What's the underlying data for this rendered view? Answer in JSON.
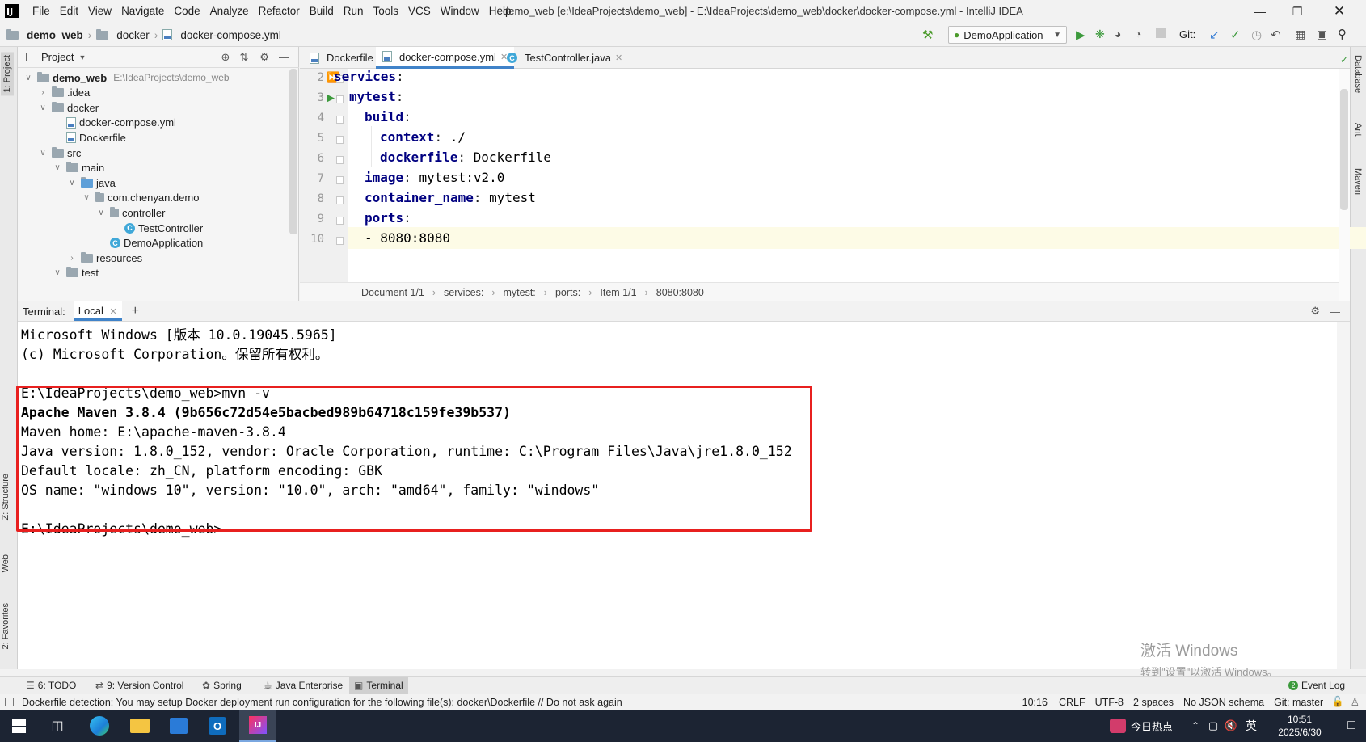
{
  "menubar": {
    "logo": "IJ",
    "items": [
      "File",
      "Edit",
      "View",
      "Navigate",
      "Code",
      "Analyze",
      "Refactor",
      "Build",
      "Run",
      "Tools",
      "VCS",
      "Window",
      "Help"
    ],
    "title": "demo_web [e:\\IdeaProjects\\demo_web] - E:\\IdeaProjects\\demo_web\\docker\\docker-compose.yml - IntelliJ IDEA"
  },
  "navbar": {
    "crumbs": [
      "demo_web",
      "docker",
      "docker-compose.yml"
    ],
    "run_config": "DemoApplication",
    "git_label": "Git:"
  },
  "leftstrip": {
    "project": "1: Project",
    "structure": "Z: Structure",
    "web": "Web",
    "favorites": "2: Favorites"
  },
  "rightstrip": {
    "database": "Database",
    "ant": "Ant",
    "maven": "Maven"
  },
  "project": {
    "title": "Project",
    "tree": [
      {
        "label": "demo_web",
        "extra": "E:\\IdeaProjects\\demo_web",
        "indent": 0,
        "arrow": "v",
        "type": "folder",
        "bold": true
      },
      {
        "label": ".idea",
        "extra": "",
        "indent": 1,
        "arrow": ">",
        "type": "folder",
        "bold": false
      },
      {
        "label": "docker",
        "extra": "",
        "indent": 1,
        "arrow": "v",
        "type": "folder",
        "bold": false
      },
      {
        "label": "docker-compose.yml",
        "extra": "",
        "indent": 2,
        "arrow": "",
        "type": "yml",
        "bold": false
      },
      {
        "label": "Dockerfile",
        "extra": "",
        "indent": 2,
        "arrow": "",
        "type": "yml",
        "bold": false
      },
      {
        "label": "src",
        "extra": "",
        "indent": 1,
        "arrow": "v",
        "type": "folder",
        "bold": false
      },
      {
        "label": "main",
        "extra": "",
        "indent": 2,
        "arrow": "v",
        "type": "folder",
        "bold": false
      },
      {
        "label": "java",
        "extra": "",
        "indent": 3,
        "arrow": "v",
        "type": "folderblue",
        "bold": false
      },
      {
        "label": "com.chenyan.demo",
        "extra": "",
        "indent": 4,
        "arrow": "v",
        "type": "pkg",
        "bold": false
      },
      {
        "label": "controller",
        "extra": "",
        "indent": 5,
        "arrow": "v",
        "type": "pkg",
        "bold": false
      },
      {
        "label": "TestController",
        "extra": "",
        "indent": 6,
        "arrow": "",
        "type": "class",
        "bold": false
      },
      {
        "label": "DemoApplication",
        "extra": "",
        "indent": 5,
        "arrow": "",
        "type": "class",
        "bold": false
      },
      {
        "label": "resources",
        "extra": "",
        "indent": 3,
        "arrow": ">",
        "type": "folder",
        "bold": false
      },
      {
        "label": "test",
        "extra": "",
        "indent": 2,
        "arrow": "v",
        "type": "folder",
        "bold": false
      }
    ]
  },
  "editor": {
    "tabs": [
      {
        "label": "Dockerfile",
        "active": false
      },
      {
        "label": "docker-compose.yml",
        "active": true
      },
      {
        "label": "TestController.java",
        "active": false
      }
    ],
    "lines": [
      {
        "n": "2",
        "key": "services",
        "val": "",
        "indent": 0
      },
      {
        "n": "3",
        "key": "mytest",
        "val": "",
        "indent": 1
      },
      {
        "n": "4",
        "key": "build",
        "val": "",
        "indent": 2
      },
      {
        "n": "5",
        "key": "context",
        "val": " ./",
        "indent": 3
      },
      {
        "n": "6",
        "key": "dockerfile",
        "val": " Dockerfile",
        "indent": 3
      },
      {
        "n": "7",
        "key": "image",
        "val": " mytest:v2.0",
        "indent": 2
      },
      {
        "n": "8",
        "key": "container_name",
        "val": " mytest",
        "indent": 2
      },
      {
        "n": "9",
        "key": "ports",
        "val": "",
        "indent": 2
      },
      {
        "n": "10",
        "key": "",
        "val": "- 8080:8080",
        "indent": 2
      }
    ],
    "breadcrumb": [
      "Document 1/1",
      "services:",
      "mytest:",
      "ports:",
      "Item 1/1",
      "8080:8080"
    ]
  },
  "terminal": {
    "label": "Terminal:",
    "tab": "Local",
    "lines": [
      {
        "text": "Microsoft Windows [版本 10.0.19045.5965]",
        "bold": false
      },
      {
        "text": "(c) Microsoft Corporation。保留所有权利。",
        "bold": false
      },
      {
        "text": "",
        "bold": false
      },
      {
        "text": "E:\\IdeaProjects\\demo_web>mvn -v",
        "bold": false
      },
      {
        "text": "Apache Maven 3.8.4 (9b656c72d54e5bacbed989b64718c159fe39b537)",
        "bold": true
      },
      {
        "text": "Maven home: E:\\apache-maven-3.8.4",
        "bold": false
      },
      {
        "text": "Java version: 1.8.0_152, vendor: Oracle Corporation, runtime: C:\\Program Files\\Java\\jre1.8.0_152",
        "bold": false
      },
      {
        "text": "Default locale: zh_CN, platform encoding: GBK",
        "bold": false
      },
      {
        "text": "OS name: \"windows 10\", version: \"10.0\", arch: \"amd64\", family: \"windows\"",
        "bold": false
      },
      {
        "text": "",
        "bold": false
      },
      {
        "text": "E:\\IdeaProjects\\demo_web>",
        "bold": false
      }
    ],
    "watermark1": "激活 Windows",
    "watermark2": "转到\"设置\"以激活 Windows。"
  },
  "toolwindows": [
    {
      "label": "6: TODO",
      "active": false
    },
    {
      "label": "9: Version Control",
      "active": false
    },
    {
      "label": "Spring",
      "active": false
    },
    {
      "label": "Java Enterprise",
      "active": false
    },
    {
      "label": "Terminal",
      "active": true
    }
  ],
  "event_log": "Event Log",
  "event_count": "2",
  "status": {
    "message": "Dockerfile detection: You may setup Docker deployment run configuration for the following file(s): docker\\Dockerfile // Do not ask again",
    "position": "10:16",
    "line_sep": "CRLF",
    "encoding": "UTF-8",
    "indent": "2 spaces",
    "schema": "No JSON schema",
    "git": "Git: master"
  },
  "taskbar": {
    "news": "今日热点",
    "ime": "英",
    "time": "10:51",
    "date": "2025/6/30"
  },
  "colors": {
    "highlight_box": "#e8201f",
    "keyword": "#000080",
    "tab_accent": "#4083c9"
  }
}
